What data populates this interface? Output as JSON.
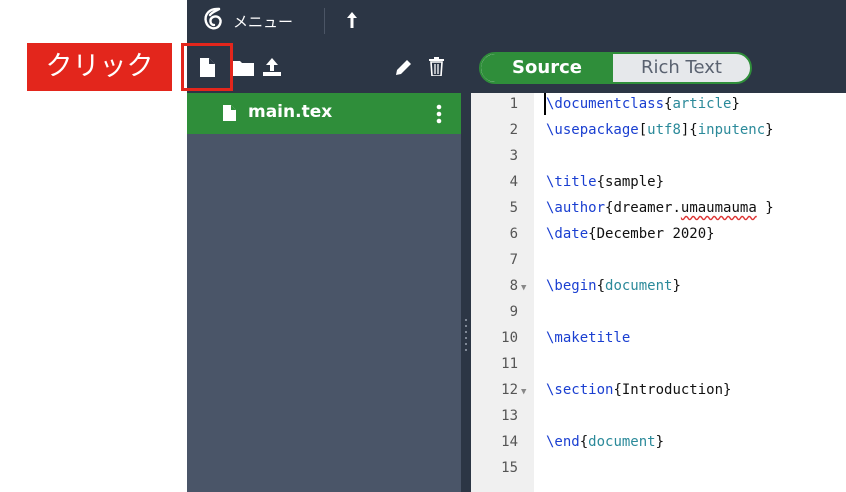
{
  "topbar": {
    "menu_label": "メニュー",
    "logo_icon": "overleaf-logo-icon",
    "upload_icon": "arrow-up-icon"
  },
  "toolbar": {
    "icons": [
      "new-file-icon",
      "new-folder-icon",
      "upload-icon",
      "rename-pencil-icon",
      "delete-trash-icon"
    ]
  },
  "filetree": {
    "files": [
      {
        "name": "main.tex",
        "selected": true
      }
    ]
  },
  "editor": {
    "toggle": {
      "source_label": "Source",
      "rich_label": "Rich Text",
      "active": "Source"
    },
    "lines": [
      {
        "n": "1"
      },
      {
        "n": "2"
      },
      {
        "n": "3"
      },
      {
        "n": "4"
      },
      {
        "n": "5"
      },
      {
        "n": "6"
      },
      {
        "n": "7"
      },
      {
        "n": "8"
      },
      {
        "n": "9"
      },
      {
        "n": "10"
      },
      {
        "n": "11"
      },
      {
        "n": "12"
      },
      {
        "n": "13"
      },
      {
        "n": "14"
      },
      {
        "n": "15"
      }
    ],
    "code": {
      "l1_cmd": "\\documentclass",
      "l1_arg": "article",
      "l2_cmd": "\\usepackage",
      "l2_opt": "utf8",
      "l2_arg": "inputenc",
      "l4_cmd": "\\title",
      "l4_arg": "sample",
      "l5_cmd": "\\author",
      "l5_arg_a": "dreamer.",
      "l5_arg_b": "umaumauma",
      "l5_arg_c": " ",
      "l6_cmd": "\\date",
      "l6_arg": "December 2020",
      "l8_cmd": "\\begin",
      "l8_arg": "document",
      "l10_cmd": "\\maketitle",
      "l12_cmd": "\\section",
      "l12_arg": "Introduction",
      "l14_cmd": "\\end",
      "l14_arg": "document"
    }
  },
  "annotation": {
    "label": "クリック",
    "color": "#e3261c"
  },
  "colors": {
    "accent_green": "#2f8e3a",
    "dark_bar": "#2c3645",
    "tree_bg": "#4a5568"
  }
}
